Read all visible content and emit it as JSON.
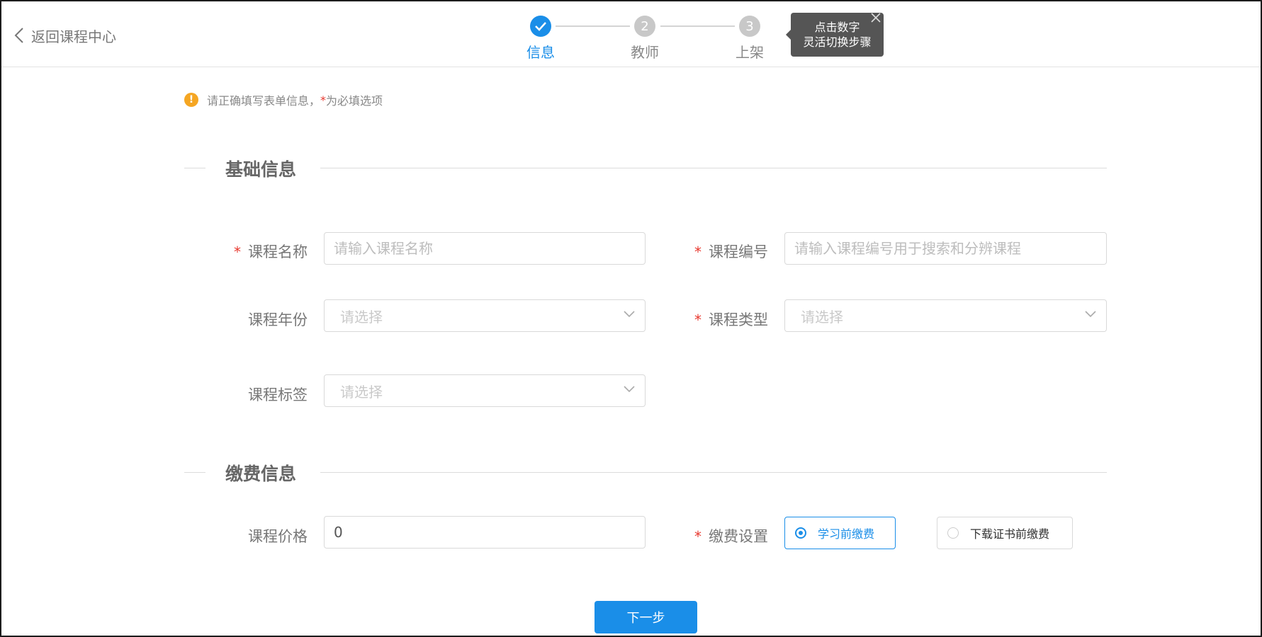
{
  "header": {
    "back_label": "返回课程中心",
    "steps": [
      {
        "number": "1",
        "label": "信息",
        "status": "done"
      },
      {
        "number": "2",
        "label": "教师",
        "status": "pending"
      },
      {
        "number": "3",
        "label": "上架",
        "status": "pending"
      }
    ],
    "tooltip": {
      "line1": "点击数字",
      "line2": "灵活切换步骤"
    }
  },
  "notice": {
    "text_before": "请正确填写表单信息，",
    "star": "*",
    "text_after": "为必填选项"
  },
  "sections": {
    "basic": {
      "title": "基础信息"
    },
    "payment": {
      "title": "缴费信息"
    }
  },
  "form": {
    "course_name": {
      "label": "课程名称",
      "required": true,
      "placeholder": "请输入课程名称",
      "value": ""
    },
    "course_code": {
      "label": "课程编号",
      "required": true,
      "placeholder": "请输入课程编号用于搜索和分辨课程",
      "value": ""
    },
    "course_year": {
      "label": "课程年份",
      "required": false,
      "placeholder": "请选择"
    },
    "course_type": {
      "label": "课程类型",
      "required": true,
      "placeholder": "请选择"
    },
    "course_tags": {
      "label": "课程标签",
      "required": false,
      "placeholder": "请选择"
    },
    "course_price": {
      "label": "课程价格",
      "required": false,
      "value": "0"
    },
    "payment_setting": {
      "label": "缴费设置",
      "required": true,
      "options": [
        {
          "label": "学习前缴费",
          "checked": true
        },
        {
          "label": "下载证书前缴费",
          "checked": false
        }
      ]
    }
  },
  "star": "*",
  "next_button": "下一步",
  "colors": {
    "accent": "#1a8ee8",
    "required": "#e8392f",
    "warning": "#f5a623"
  }
}
